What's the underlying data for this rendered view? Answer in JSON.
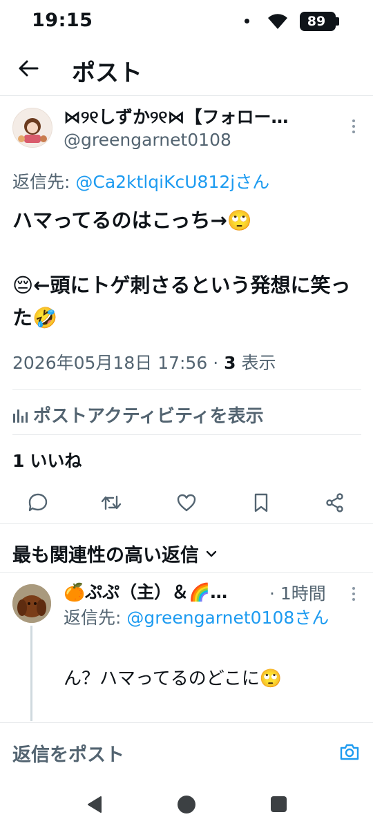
{
  "status_bar": {
    "time": "19:15",
    "battery": "89"
  },
  "header": {
    "title": "ポスト"
  },
  "post": {
    "author_name": "⋈୨୧しずか୨୧⋈【フォロー…",
    "author_handle": "@greengarnet0108",
    "reply_to_prefix": "返信先: ",
    "reply_to_mention": "@Ca2ktlqiKcU812jさん",
    "body": "ハマってるのはこっち→🙄\n\n😔←頭にトゲ刺さるという発想に笑った🤣",
    "timestamp": "2026年05月18日 17:56",
    "views_separator": " · ",
    "views_count": "3",
    "views_label": " 表示",
    "activity_label": "ポストアクティビティを表示",
    "likes_count": "1",
    "likes_label": "いいね"
  },
  "actions": [
    {
      "name": "reply",
      "icon": "comment-icon"
    },
    {
      "name": "repost",
      "icon": "repost-icon"
    },
    {
      "name": "like",
      "icon": "heart-icon"
    },
    {
      "name": "bookmark",
      "icon": "bookmark-icon"
    },
    {
      "name": "share",
      "icon": "share-icon"
    }
  ],
  "replies_section": {
    "title": "最も関連性の高い返信"
  },
  "reply": {
    "author_name": "🍊ぷぷ（主）＆🌈…",
    "time": "· 1時間",
    "reply_to_prefix": "返信先: ",
    "reply_to_mention": "@greengarnet0108さん",
    "text": "ん？ハマってるのどこに🙄"
  },
  "composer": {
    "placeholder": "返信をポスト"
  },
  "colors": {
    "accent": "#1d9bf0",
    "secondary_text": "#536471",
    "primary_text": "#0f1419"
  }
}
